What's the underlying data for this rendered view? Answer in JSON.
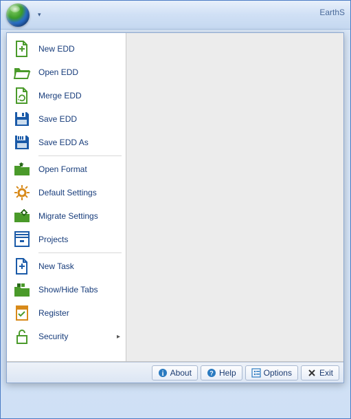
{
  "titlebar": {
    "app_title": "EarthS"
  },
  "menu": {
    "items": [
      {
        "label": "New EDD"
      },
      {
        "label": "Open EDD"
      },
      {
        "label": "Merge EDD"
      },
      {
        "label": "Save EDD"
      },
      {
        "label": "Save EDD As"
      },
      {
        "label": "Open Format"
      },
      {
        "label": "Default Settings"
      },
      {
        "label": "Migrate Settings"
      },
      {
        "label": "Projects"
      },
      {
        "label": "New Task"
      },
      {
        "label": "Show/Hide Tabs"
      },
      {
        "label": "Register"
      },
      {
        "label": "Security"
      }
    ]
  },
  "footer": {
    "about": "About",
    "help": "Help",
    "options": "Options",
    "exit": "Exit"
  }
}
